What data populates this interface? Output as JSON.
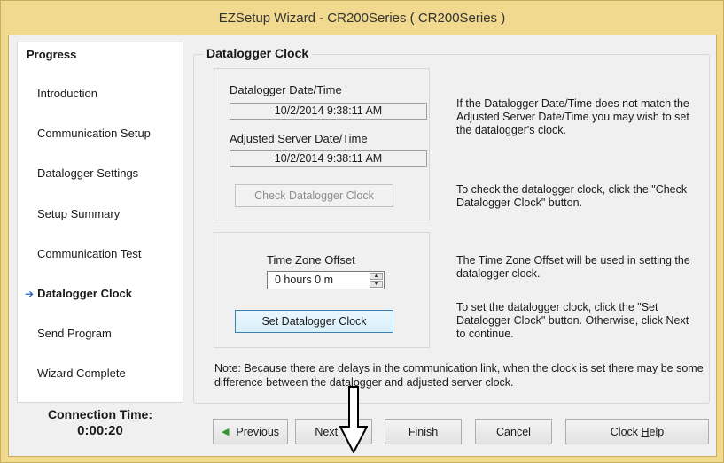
{
  "window": {
    "title": "EZSetup Wizard - CR200Series ( CR200Series )"
  },
  "progress": {
    "title": "Progress",
    "steps": [
      "Introduction",
      "Communication Setup",
      "Datalogger Settings",
      "Setup Summary",
      "Communication Test",
      "Datalogger Clock",
      "Send Program",
      "Wizard Complete"
    ],
    "active_index": 5,
    "active_icon": "arrow-right-icon"
  },
  "connection": {
    "label": "Connection Time:",
    "value": "0:00:20"
  },
  "main": {
    "title": "Datalogger Clock",
    "datalogger_time_label": "Datalogger Date/Time",
    "datalogger_time_value": "10/2/2014 9:38:11 AM",
    "server_time_label": "Adjusted Server Date/Time",
    "server_time_value": "10/2/2014 9:38:11 AM",
    "check_button": "Check Datalogger Clock",
    "tz_label": "Time Zone Offset",
    "tz_value": "0 hours 0 m",
    "set_button": "Set Datalogger Clock",
    "help1": "If the Datalogger Date/Time does not match the Adjusted Server Date/Time you may wish to set the datalogger's clock.",
    "help2": "To check the datalogger clock, click the \"Check Datalogger Clock\" button.",
    "help3": "The Time Zone Offset will be used in setting the datalogger clock.",
    "help4": "To set the datalogger clock, click the \"Set Datalogger Clock\" button. Otherwise, click Next to continue.",
    "note": "Note: Because there are delays in the communication link, when the clock is set there may be some difference between the datalogger and adjusted server clock."
  },
  "buttons": {
    "previous": "Previous",
    "next": "Next",
    "finish": "Finish",
    "cancel": "Cancel",
    "help_prefix": "Clock ",
    "help_accel": "H",
    "help_suffix": "elp"
  },
  "colors": {
    "title_bar": "#f1d98f",
    "nav_arrow": "#2f9a2f",
    "active_arrow": "#2b66c9"
  }
}
